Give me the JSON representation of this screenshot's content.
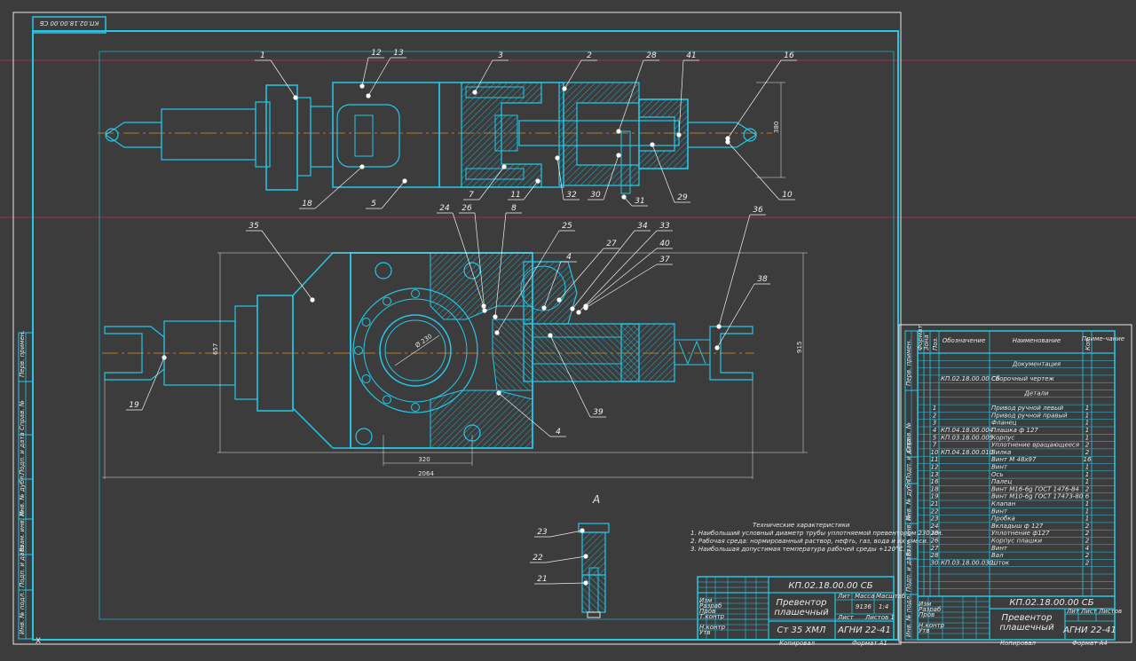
{
  "stamp_code": "КП.02.18.00.00 СБ",
  "title_block": {
    "code": "КП.02.18.00.00 СБ",
    "name_line1": "Превентор",
    "name_line2": "плашечный",
    "material": "Ст 35 ХМЛ",
    "org": "АГНИ 22-41",
    "mass": "9136",
    "scale": "1:4",
    "sheet": "Лист",
    "sheets": "Листов 1",
    "col_lit": "Лит",
    "col_mass": "Масса",
    "col_scale": "Масштаб",
    "rows": [
      "Изм",
      "Разраб",
      "Пров",
      "Т.контр",
      "Н.контр",
      "Утв"
    ],
    "copied": "Копировал",
    "format": "Формат А1"
  },
  "tech_notes": {
    "heading": "Технические характеристики",
    "lines": [
      "1. Наибольший условный диаметр трубы уплотняемой превентором 230 мм.",
      "2. Рабочая среда: нормированный раствор, нефть, газ, вода и их смеси.",
      "3. Наибольшая допустимая температура рабочей среды +120°С."
    ]
  },
  "view_label": "А",
  "callouts": [
    "1",
    "12",
    "13",
    "3",
    "2",
    "28",
    "41",
    "16",
    "18",
    "5",
    "7",
    "11",
    "32",
    "30",
    "31",
    "29",
    "10",
    "35",
    "24",
    "26",
    "8",
    "25",
    "4",
    "27",
    "34",
    "33",
    "40",
    "37",
    "36",
    "38",
    "19",
    "39",
    "4",
    "21",
    "22",
    "23"
  ],
  "dimensions": {
    "d1": "380",
    "d2": "657",
    "d3": "915",
    "d4": "320",
    "d5": "2064",
    "d6": "Ø 230"
  },
  "spec": {
    "headers": [
      "Формат",
      "Зона",
      "Поз.",
      "Обозначение",
      "Наименование",
      "Кол.",
      "Приме-чание"
    ],
    "section_docs": "Документация",
    "section_parts": "Детали",
    "doc_row": {
      "pos": "",
      "designation": "КП.02.18.00.00 СБ",
      "name": "Сборочный чертеж",
      "qty": ""
    },
    "rows": [
      {
        "pos": "1",
        "designation": "",
        "name": "Привод ручной левый",
        "qty": "1"
      },
      {
        "pos": "2",
        "designation": "",
        "name": "Привод ручной правый",
        "qty": "1"
      },
      {
        "pos": "3",
        "designation": "",
        "name": "Фланец",
        "qty": "1"
      },
      {
        "pos": "4",
        "designation": "КП.04.18.00.004",
        "name": "Плашка ф 127",
        "qty": "1"
      },
      {
        "pos": "5",
        "designation": "КП.03.18.00.005",
        "name": "Корпус",
        "qty": "1"
      },
      {
        "pos": "7",
        "designation": "",
        "name": "Уплотнение вращающееся",
        "qty": "2"
      },
      {
        "pos": "10",
        "designation": "КП.04.18.00.010",
        "name": "Вилка",
        "qty": "2"
      },
      {
        "pos": "11",
        "designation": "",
        "name": "Винт М 48х97",
        "qty": "16"
      },
      {
        "pos": "12",
        "designation": "",
        "name": "Винт",
        "qty": "1"
      },
      {
        "pos": "13",
        "designation": "",
        "name": "Ось",
        "qty": "1"
      },
      {
        "pos": "16",
        "designation": "",
        "name": "Палец",
        "qty": "1"
      },
      {
        "pos": "18",
        "designation": "",
        "name": "Винт М16-6g ГОСТ 1476-84",
        "qty": "2"
      },
      {
        "pos": "19",
        "designation": "",
        "name": "Винт М10-6g ГОСТ 17473-80",
        "qty": "6"
      },
      {
        "pos": "21",
        "designation": "",
        "name": "Клапан",
        "qty": "1"
      },
      {
        "pos": "22",
        "designation": "",
        "name": "Винт",
        "qty": "1"
      },
      {
        "pos": "23",
        "designation": "",
        "name": "Пробка",
        "qty": "1"
      },
      {
        "pos": "24",
        "designation": "",
        "name": "Вкладыш ф 127",
        "qty": "2"
      },
      {
        "pos": "25",
        "designation": "",
        "name": "Уплотнение ф127",
        "qty": "2"
      },
      {
        "pos": "26",
        "designation": "",
        "name": "Корпус плашки",
        "qty": "2"
      },
      {
        "pos": "27",
        "designation": "",
        "name": "Винт",
        "qty": "4"
      },
      {
        "pos": "28",
        "designation": "",
        "name": "Вал",
        "qty": "2"
      },
      {
        "pos": "30",
        "designation": "КП.03.18.00.030",
        "name": "Шток",
        "qty": "2"
      }
    ],
    "tb_code": "КП.02.18.00.00 СБ",
    "tb_name1": "Превентор",
    "tb_name2": "плашечный",
    "tb_org": "АГНИ 22-41",
    "tb_copied": "Копировал",
    "tb_format": "Формат А4",
    "tb_rows": [
      "Изм",
      "Разраб",
      "Пров",
      "Н.контр",
      "Утв"
    ],
    "tb_cols": [
      "Лит",
      "Лист",
      "Листов"
    ]
  },
  "left_strip": [
    "Перв. примен.",
    "Справ. №",
    "Подп. и дата",
    "Инв. № дубл.",
    "Взам. инв. №",
    "Подп. и дата",
    "Инв. № подл."
  ],
  "right_strip": [
    "Перв. примен.",
    "Справ. №",
    "Подп. и дата",
    "Инв. № дубл.",
    "Взам. инв. №",
    "Подп. и дата",
    "Инв. № подл."
  ],
  "colors": {
    "line": "#23c8e8",
    "bg": "#3c3c3c",
    "white": "#e6e6e6",
    "guide": "#a0305a",
    "center": "#e08a20"
  }
}
